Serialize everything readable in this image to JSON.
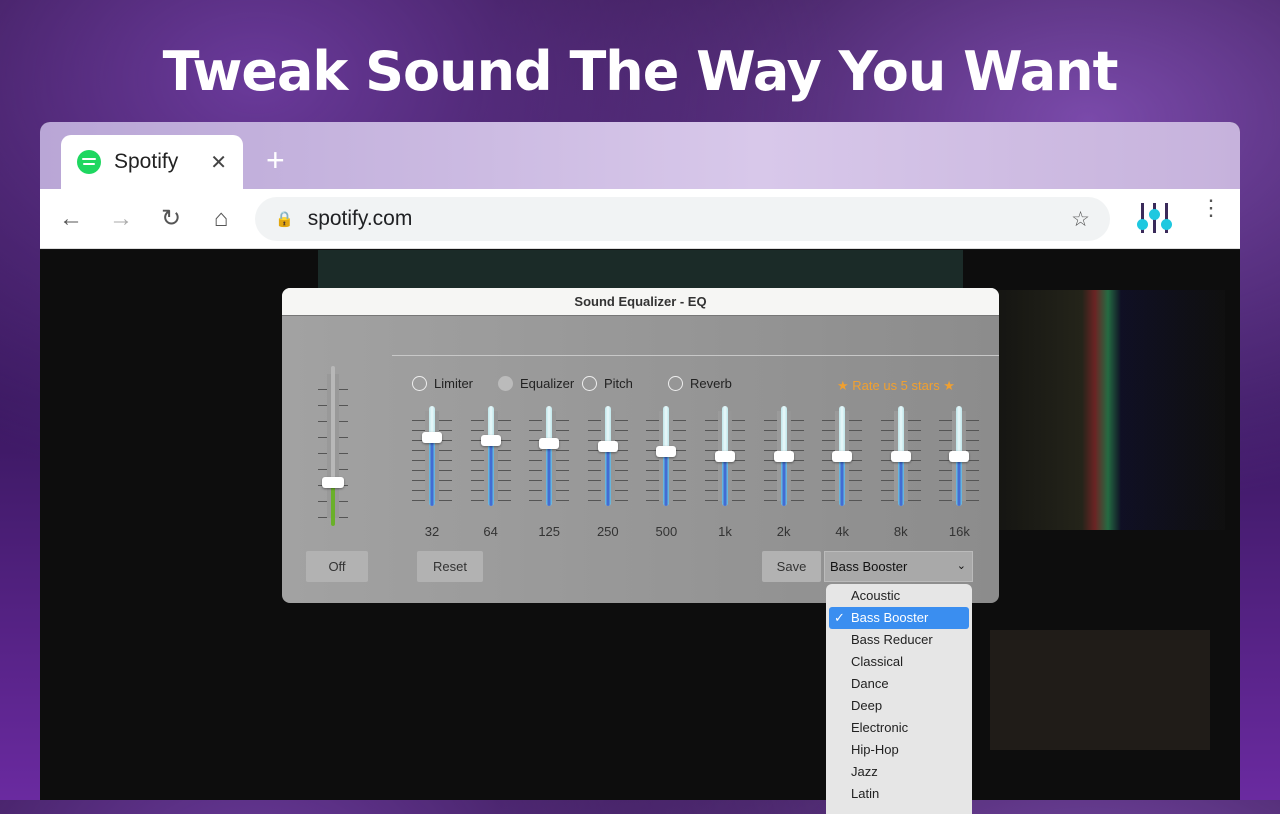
{
  "headline": "Tweak Sound The Way You Want",
  "browser": {
    "tab_title": "Spotify",
    "tab_close": "✕",
    "new_tab": "+",
    "url": "spotify.com",
    "back": "←",
    "forward": "→",
    "reload": "↻",
    "home": "⌂",
    "lock": "🔒",
    "star": "☆",
    "menu": "⋮"
  },
  "dialog": {
    "title": "Sound Equalizer - EQ",
    "modes": [
      {
        "label": "Limiter",
        "selected": false
      },
      {
        "label": "Equalizer",
        "selected": true
      },
      {
        "label": "Pitch",
        "selected": false
      },
      {
        "label": "Reverb",
        "selected": false
      }
    ],
    "rate": "★ Rate us 5 stars ★",
    "volume_level": 0.27,
    "gain_range_db": [
      -12,
      12
    ],
    "bands": [
      {
        "label": "32",
        "gain": 4.4
      },
      {
        "label": "64",
        "gain": 3.7
      },
      {
        "label": "125",
        "gain": 2.9
      },
      {
        "label": "250",
        "gain": 2.2
      },
      {
        "label": "500",
        "gain": 1.0
      },
      {
        "label": "1k",
        "gain": 0
      },
      {
        "label": "2k",
        "gain": 0
      },
      {
        "label": "4k",
        "gain": 0
      },
      {
        "label": "8k",
        "gain": 0
      },
      {
        "label": "16k",
        "gain": 0
      }
    ],
    "off_label": "Off",
    "reset_label": "Reset",
    "save_label": "Save",
    "preset": "Bass Booster",
    "chevron": "⌄",
    "presets": [
      "Acoustic",
      "Bass Booster",
      "Bass Reducer",
      "Classical",
      "Dance",
      "Deep",
      "Electronic",
      "Hip-Hop",
      "Jazz",
      "Latin"
    ],
    "check": "✓",
    "colors": {
      "accent": "#3a8ef0",
      "rate": "#f0a030",
      "volume": "#6ab02a"
    }
  }
}
